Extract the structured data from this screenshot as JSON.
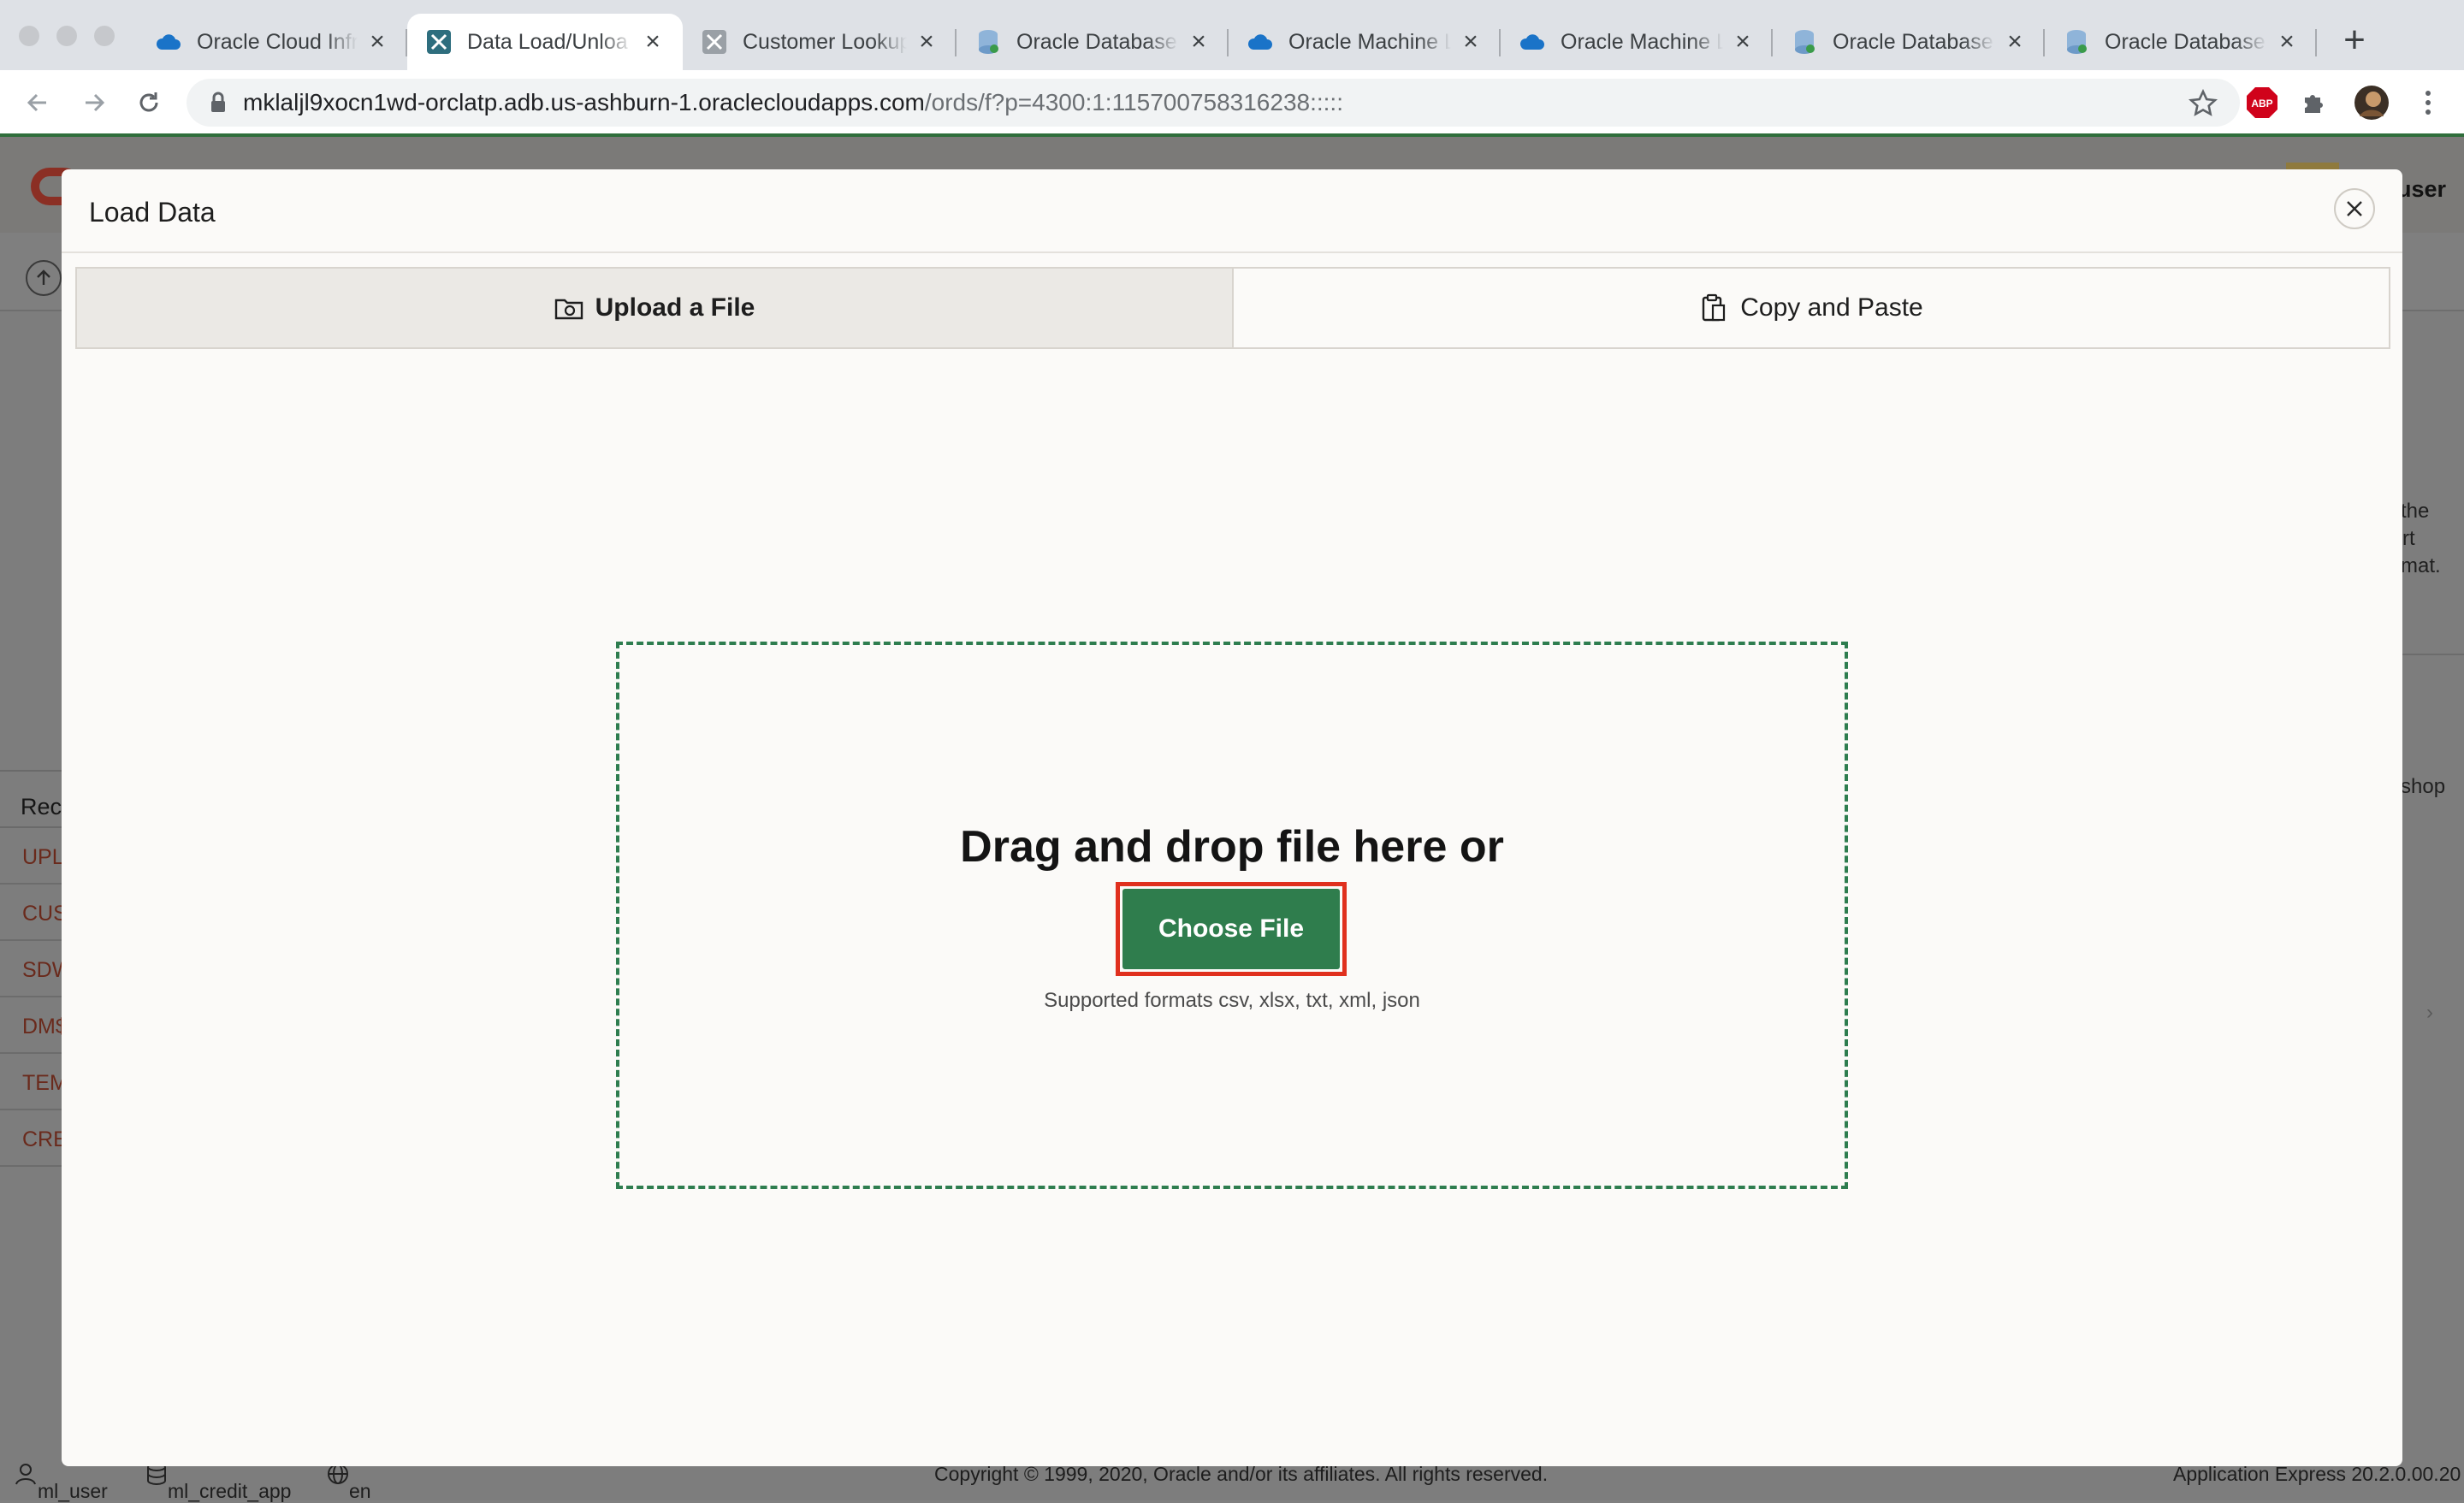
{
  "browser": {
    "tabs": [
      {
        "label": "Oracle Cloud Infr",
        "icon": "cloud-icon",
        "active": false
      },
      {
        "label": "Data Load/Unloa",
        "icon": "apex-icon",
        "active": true
      },
      {
        "label": "Customer Lookup",
        "icon": "apex-icon",
        "active": false
      },
      {
        "label": "Oracle Database",
        "icon": "database-icon",
        "active": false
      },
      {
        "label": "Oracle Machine L",
        "icon": "cloud-icon",
        "active": false
      },
      {
        "label": "Oracle Machine L",
        "icon": "cloud-icon",
        "active": false
      },
      {
        "label": "Oracle Database",
        "icon": "database-icon",
        "active": false
      },
      {
        "label": "Oracle Database",
        "icon": "database-icon",
        "active": false
      }
    ],
    "url_host": "mklaljl9xocn1wd-orclatp.adb.us-ashburn-1.oraclecloudapps.com",
    "url_path": "/ords/f?p=4300:1:115700758316238:::::"
  },
  "background_app": {
    "user": "user",
    "side_text": [
      "the",
      "rt",
      "mat.",
      "shop"
    ],
    "recent_heading": "Rec",
    "recent_items": [
      "UPL",
      "CUS",
      "SDW",
      "DM$",
      "TEM",
      "CRE"
    ],
    "footer": {
      "user": "ml_user",
      "workspace": "ml_credit_app",
      "language": "en",
      "copyright": "Copyright © 1999, 2020, Oracle and/or its affiliates. All rights reserved.",
      "version": "Application Express 20.2.0.00.20"
    }
  },
  "modal": {
    "title": "Load Data",
    "tabs": [
      {
        "label": "Upload a File",
        "icon": "folder-upload-icon",
        "selected": true
      },
      {
        "label": "Copy and Paste",
        "icon": "clipboard-icon",
        "selected": false
      }
    ],
    "dropzone": {
      "title": "Drag and drop file here or",
      "button": "Choose File",
      "formats": "Supported formats csv, xlsx, txt, xml, json"
    }
  },
  "colors": {
    "accent_green": "#2f7d4d",
    "highlight_red": "#e0301e",
    "dropzone_border": "#2e7d4f"
  }
}
